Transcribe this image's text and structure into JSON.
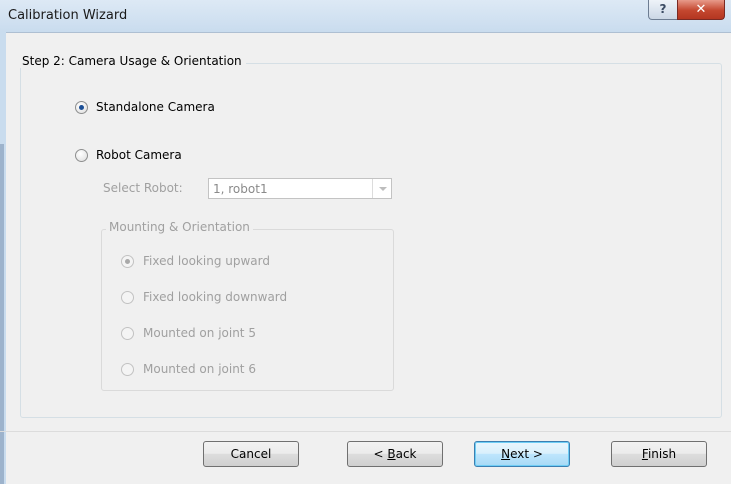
{
  "window": {
    "title": "Calibration Wizard",
    "help_glyph": "?",
    "close_glyph": "✕"
  },
  "step": {
    "caption": "Step 2: Camera Usage & Orientation"
  },
  "usage": {
    "standalone_label": "Standalone Camera",
    "standalone_selected": true,
    "robot_label": "Robot Camera",
    "robot_selected": false
  },
  "robot_select": {
    "label": "Select Robot:",
    "value": "1, robot1"
  },
  "mounting": {
    "caption": "Mounting & Orientation",
    "options": [
      {
        "label": "Fixed looking upward",
        "selected": true
      },
      {
        "label": "Fixed looking downward",
        "selected": false
      },
      {
        "label": "Mounted on joint 5",
        "selected": false
      },
      {
        "label": "Mounted on joint 6",
        "selected": false
      }
    ]
  },
  "buttons": {
    "cancel": "Cancel",
    "back_prefix": "< ",
    "back_key": "B",
    "back_rest": "ack",
    "next_key": "N",
    "next_rest": "ext >",
    "finish_key": "F",
    "finish_rest": "inish"
  },
  "colors": {
    "radio_dot": "#1b4f96",
    "close_button": "#c4472f",
    "default_button_border": "#3c7fb1"
  }
}
